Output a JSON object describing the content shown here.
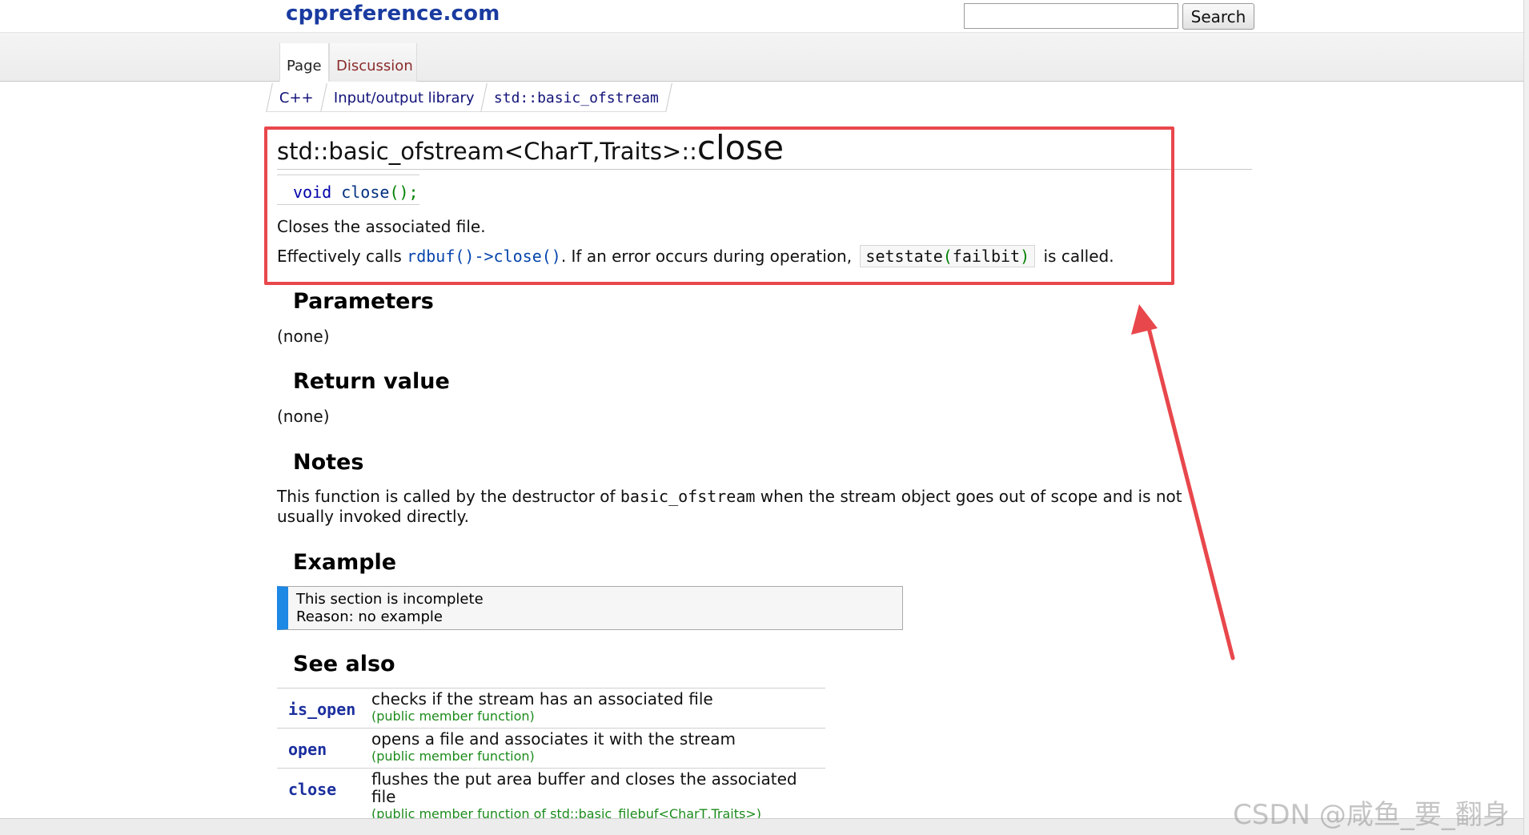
{
  "header": {
    "site_title": "cppreference.com",
    "search_placeholder": "",
    "search_button": "Search"
  },
  "tabs": [
    {
      "label": "Page"
    },
    {
      "label": "Discussion"
    }
  ],
  "breadcrumb": [
    "C++",
    "Input/output library",
    "std::basic_ofstream"
  ],
  "title": {
    "prefix": "std::basic_ofstream<CharT,Traits>::",
    "name": "close"
  },
  "declaration": {
    "keyword": "void",
    "func": "close",
    "punct": "();"
  },
  "description": {
    "line1": "Closes the associated file.",
    "line2_prefix": "Effectively calls",
    "line2_code": "rdbuf()->close()",
    "line2_mid": ". If an error occurs during operation,",
    "line2_code2_fn": "setstate",
    "line2_code2_open": "(",
    "line2_code2_arg": "failbit",
    "line2_code2_close": ")",
    "line2_suffix": "is called."
  },
  "sections": {
    "parameters": {
      "heading": "Parameters",
      "body": "(none)"
    },
    "return_value": {
      "heading": "Return value",
      "body": "(none)"
    },
    "notes": {
      "heading": "Notes",
      "body_prefix": "This function is called by the destructor of",
      "body_code": "basic_ofstream",
      "body_suffix": "when the stream object goes out of scope and is not usually invoked directly."
    },
    "example": {
      "heading": "Example",
      "incomplete_line1": "This section is incomplete",
      "incomplete_line2": "Reason: no example"
    },
    "see_also": {
      "heading": "See also",
      "rows": [
        {
          "name": "is_open",
          "desc": "checks if the stream has an associated file",
          "kind": "(public member function)"
        },
        {
          "name": "open",
          "desc": "opens a file and associates it with the stream",
          "kind": "(public member function)"
        },
        {
          "name": "close",
          "desc": "flushes the put area buffer and closes the associated file",
          "kind": "(public member function of std::basic_filebuf<CharT,Traits>)"
        }
      ]
    }
  },
  "annotation": {
    "color": "#e8474c"
  },
  "watermark": "CSDN @咸鱼_要_翻身"
}
